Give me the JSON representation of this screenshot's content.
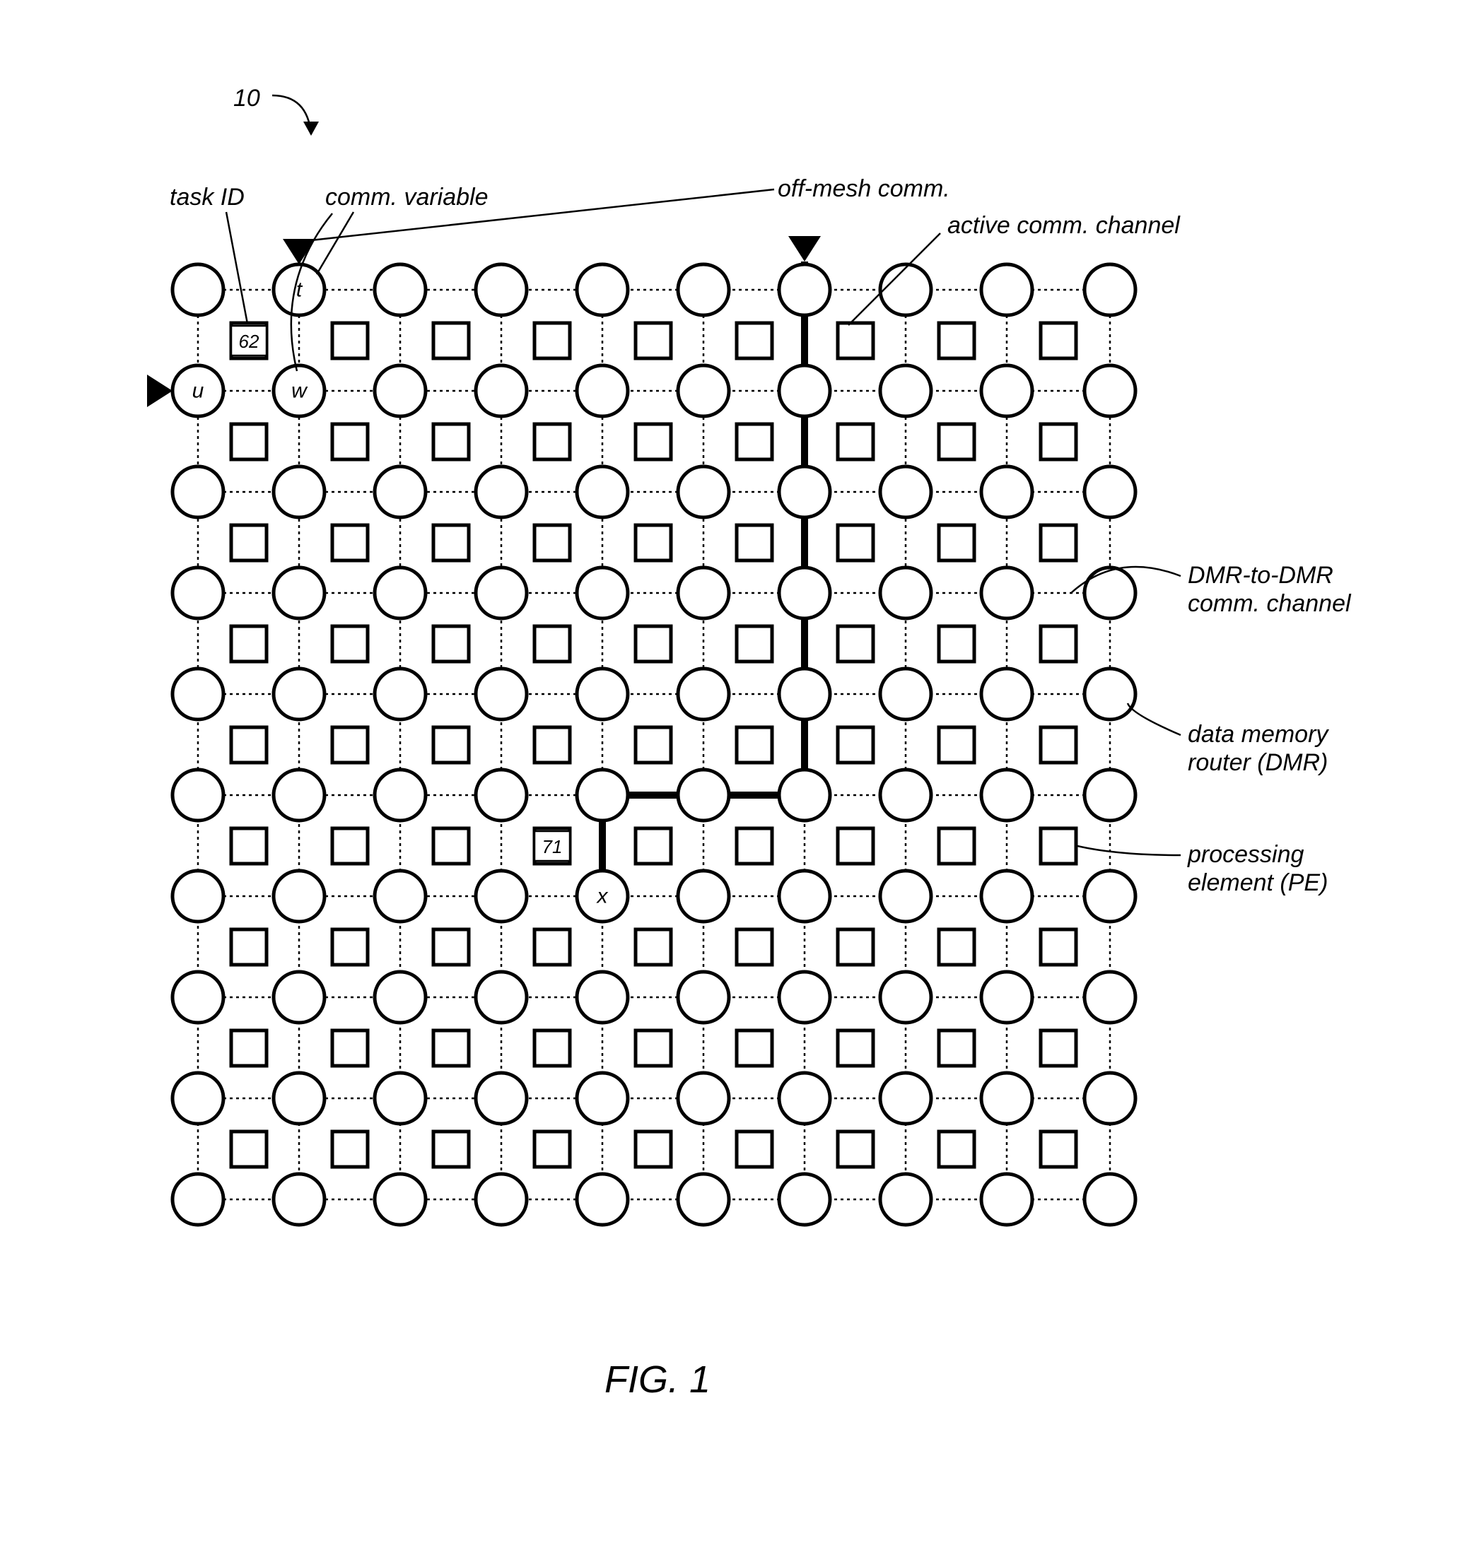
{
  "figure": {
    "reference": "10",
    "caption": "FIG. 1"
  },
  "labels": {
    "task_id": "task ID",
    "comm_variable": "comm. variable",
    "off_mesh_comm": "off-mesh comm.",
    "active_comm_channel": "active comm. channel",
    "dmr_to_dmr": "DMR-to-DMR comm. channel",
    "dmr": "data memory router (DMR)",
    "pe": "processing element (PE)"
  },
  "nodes": {
    "t": "t",
    "u": "u",
    "w": "w",
    "x": "x"
  },
  "tasks": {
    "task62": "62",
    "task71": "71"
  }
}
